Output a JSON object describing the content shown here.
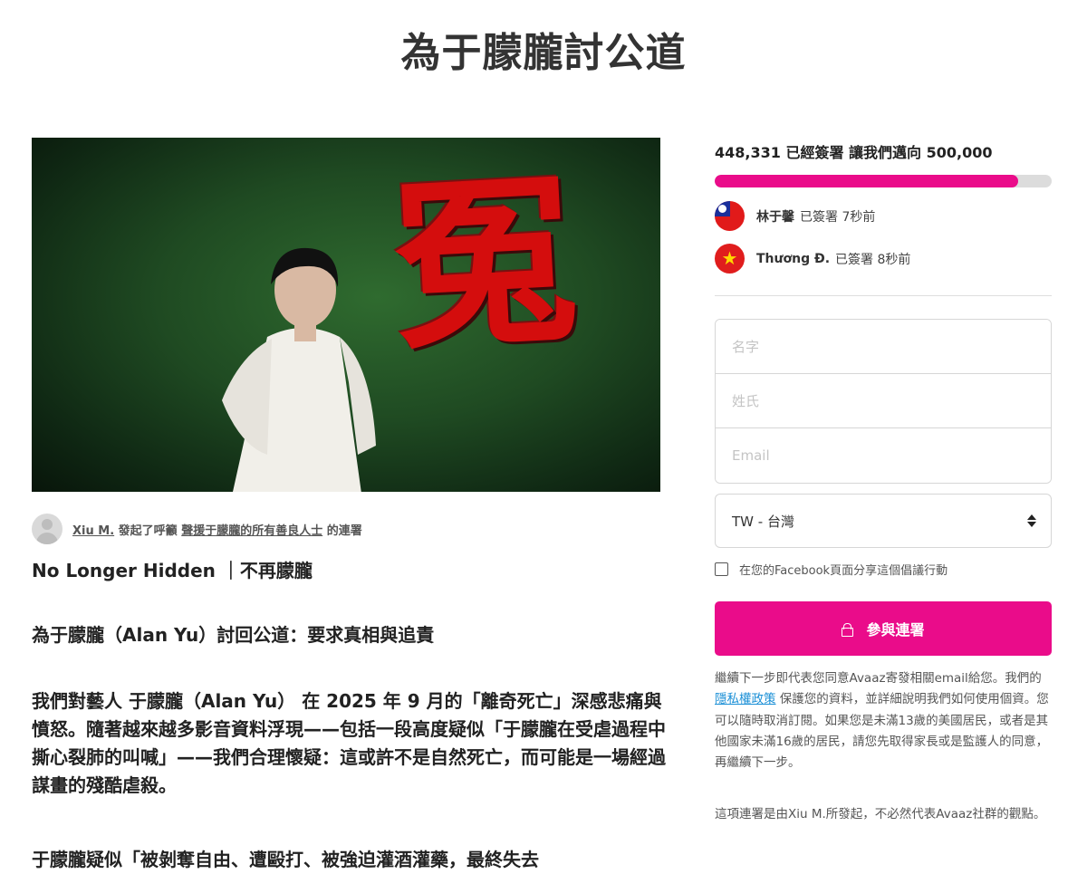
{
  "page_title": "為于朦朧討公道",
  "hero": {
    "glyph": "冤"
  },
  "starter": {
    "name": "Xiu M.",
    "text1": "發起了呼籲",
    "target": "聲援于朦朧的所有善良人士",
    "text2": "的連署"
  },
  "body": {
    "p1": "No Longer Hidden ｜不再朦朧",
    "p2": "為于朦朧（Alan Yu）討回公道：要求真相與追責",
    "p3": "我們對藝人 于朦朧（Alan Yu） 在 2025 年 9 月的「離奇死亡」深感悲痛與憤怒。隨著越來越多影音資料浮現——包括一段高度疑似「于朦朧在受虐過程中撕心裂肺的叫喊」——我們合理懷疑：這或許不是自然死亡，而可能是一場經過謀畫的殘酷虐殺。",
    "p4": "于朦朧疑似「被剝奪自由、遭毆打、被強迫灌酒灌藥，最終失去"
  },
  "signatures": {
    "count": "448,331",
    "signed_label": "已經簽署",
    "goal_label": "讓我們邁向",
    "goal": "500,000",
    "progress_fraction": 0.9
  },
  "recent_signers": [
    {
      "name": "林于馨",
      "text": "已簽署 7秒前",
      "flag": "taiwan-flag-icon"
    },
    {
      "name": "Thương Đ.",
      "text": "已簽署 8秒前",
      "flag": "vietnam-flag-icon"
    }
  ],
  "form": {
    "first_name_placeholder": "名字",
    "last_name_placeholder": "姓氏",
    "email_placeholder": "Email",
    "country_value": "TW - 台灣",
    "facebook_label": "在您的Facebook頁面分享這個倡議行動",
    "sign_label": "參與連署"
  },
  "disclaimer": {
    "part1": "繼續下一步即代表您同意Avaaz寄發相關email給您。我們的",
    "privacy_link": "隱私權政策",
    "part2": "保護您的資料，並詳細說明我們如何使用個資。您可以隨時取消訂閱。如果您是未滿13歲的美國居民，或者是其他國家未滿16歲的居民，請您先取得家長或是監護人的同意，再繼續下一步。"
  },
  "note": "這項連署是由Xiu M.所發起，不必然代表Avaaz社群的觀點。",
  "colors": {
    "accent": "#ea0c8a",
    "link": "#1a8fd6"
  }
}
